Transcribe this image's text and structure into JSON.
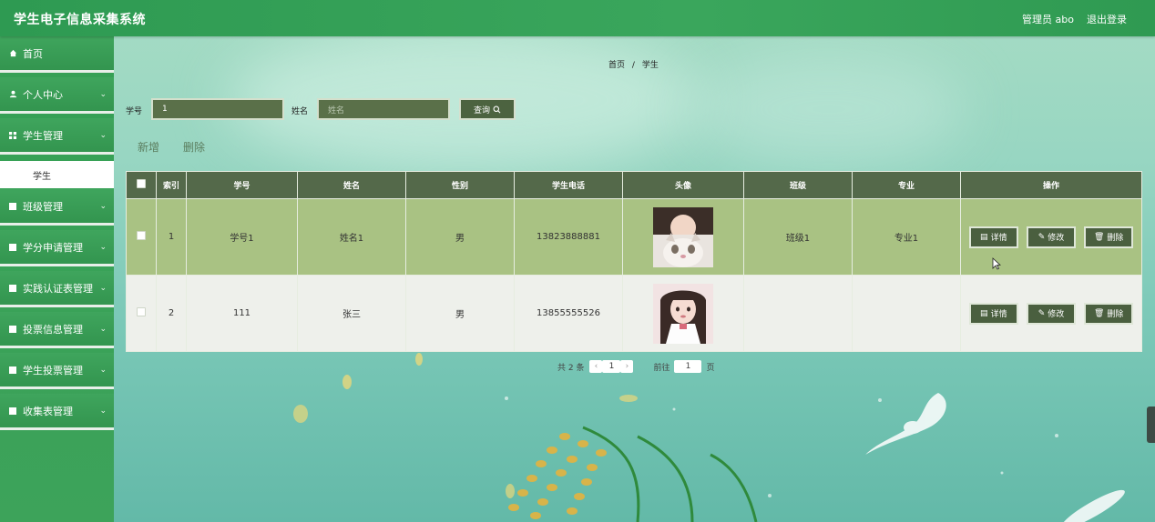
{
  "header": {
    "app_title": "学生电子信息采集系统",
    "user_label": "管理员 abo",
    "logout_label": "退出登录"
  },
  "sidebar": {
    "items": [
      {
        "label": "首页",
        "icon": "home-icon",
        "has_chevron": false
      },
      {
        "label": "个人中心",
        "icon": "user-icon",
        "has_chevron": true
      },
      {
        "label": "学生管理",
        "icon": "grid-icon",
        "has_chevron": true
      },
      {
        "label": "学生",
        "icon": "",
        "sub": true,
        "active": true
      },
      {
        "label": "班级管理",
        "icon": "grid-icon",
        "has_chevron": true
      },
      {
        "label": "学分申请管理",
        "icon": "grid-icon",
        "has_chevron": true
      },
      {
        "label": "实践认证表管理",
        "icon": "grid-icon",
        "has_chevron": true
      },
      {
        "label": "投票信息管理",
        "icon": "grid-icon",
        "has_chevron": true
      },
      {
        "label": "学生投票管理",
        "icon": "grid-icon",
        "has_chevron": true
      },
      {
        "label": "收集表管理",
        "icon": "grid-icon",
        "has_chevron": true
      }
    ]
  },
  "breadcrumb": {
    "home": "首页",
    "separator": "/",
    "current": "学生"
  },
  "search": {
    "id_label": "学号",
    "id_value": "1",
    "name_label": "姓名",
    "name_placeholder": "姓名",
    "button_label": "查询"
  },
  "actions": {
    "add_label": "新增",
    "delete_label": "删除"
  },
  "table": {
    "columns": [
      "索引",
      "学号",
      "姓名",
      "性别",
      "学生电话",
      "头像",
      "班级",
      "专业",
      "操作"
    ],
    "rows": [
      {
        "index": "1",
        "student_id": "学号1",
        "name": "姓名1",
        "gender": "男",
        "phone": "13823888881",
        "class": "班级1",
        "major": "专业1"
      },
      {
        "index": "2",
        "student_id": "111",
        "name": "张三",
        "gender": "男",
        "phone": "13855555526",
        "class": "",
        "major": ""
      }
    ],
    "row_buttons": {
      "detail": "详情",
      "edit": "修改",
      "delete": "删除"
    }
  },
  "pagination": {
    "total": "共 2 条",
    "current_page": "1",
    "goto_label": "前往",
    "goto_value": "1",
    "page_unit": "页"
  },
  "colors": {
    "topbar": "#3aa65c",
    "sidebar": "#35a055",
    "table_header": "#54694a",
    "row_selected": "#a9c283",
    "button": "#4a5f3f"
  }
}
